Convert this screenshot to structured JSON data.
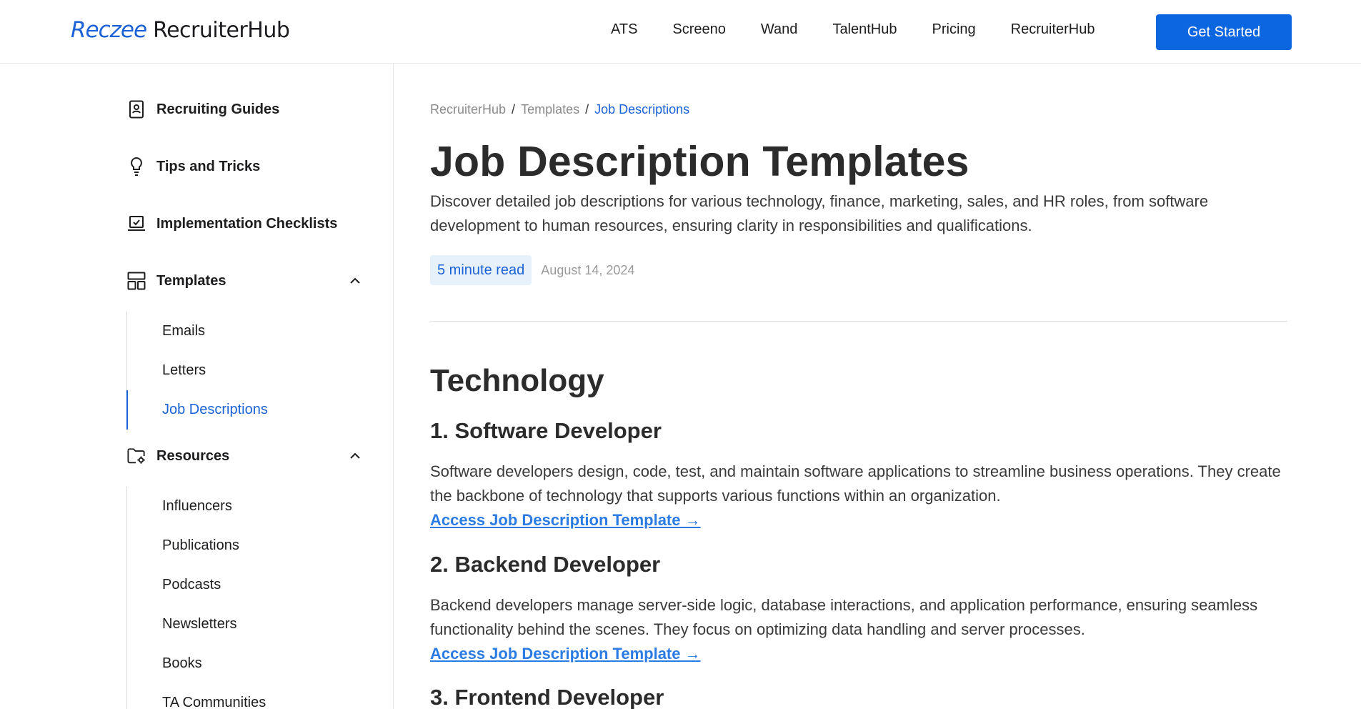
{
  "header": {
    "logo_mark": "Reczee",
    "logo_text": "RecruiterHub",
    "nav": [
      "ATS",
      "Screeno",
      "Wand",
      "TalentHub",
      "Pricing",
      "RecruiterHub"
    ],
    "cta_label": "Get Started"
  },
  "sidebar": {
    "sections": [
      {
        "label": "Recruiting Guides",
        "icon": "contact-book-icon"
      },
      {
        "label": "Tips and Tricks",
        "icon": "lightbulb-icon"
      },
      {
        "label": "Implementation Checklists",
        "icon": "laptop-check-icon"
      },
      {
        "label": "Templates",
        "icon": "layout-icon",
        "expanded": true
      },
      {
        "label": "Resources",
        "icon": "folder-gear-icon",
        "expanded": true
      }
    ],
    "templates_items": [
      "Emails",
      "Letters",
      "Job Descriptions"
    ],
    "active_item": "Job Descriptions",
    "resources_items": [
      "Influencers",
      "Publications",
      "Podcasts",
      "Newsletters",
      "Books",
      "TA Communities"
    ]
  },
  "breadcrumb": [
    "RecruiterHub",
    "Templates",
    "Job Descriptions"
  ],
  "page": {
    "title": "Job Description Templates",
    "intro": "Discover detailed job descriptions for various technology, finance, marketing, sales, and HR roles, from software development to human resources, ensuring clarity in responsibilities and qualifications.",
    "read_time": "5 minute read",
    "date": "August 14, 2024",
    "section_title": "Technology"
  },
  "jobs": [
    {
      "title": "1. Software Developer",
      "desc": "Software developers design, code, test, and maintain software applications to streamline business operations. They create the backbone of technology that supports various functions within an organization.",
      "link": "Access Job Description Template →"
    },
    {
      "title": "2. Backend Developer",
      "desc": "Backend developers manage server-side logic, database interactions, and application performance, ensuring seamless functionality behind the scenes. They focus on optimizing data handling and server processes.",
      "link": "Access Job Description Template →"
    },
    {
      "title": "3. Frontend Developer"
    }
  ],
  "colors": {
    "accent": "#1a62d6",
    "cta": "#0b66df",
    "link": "#2a7be4",
    "badge_bg": "#e7f1fc"
  }
}
